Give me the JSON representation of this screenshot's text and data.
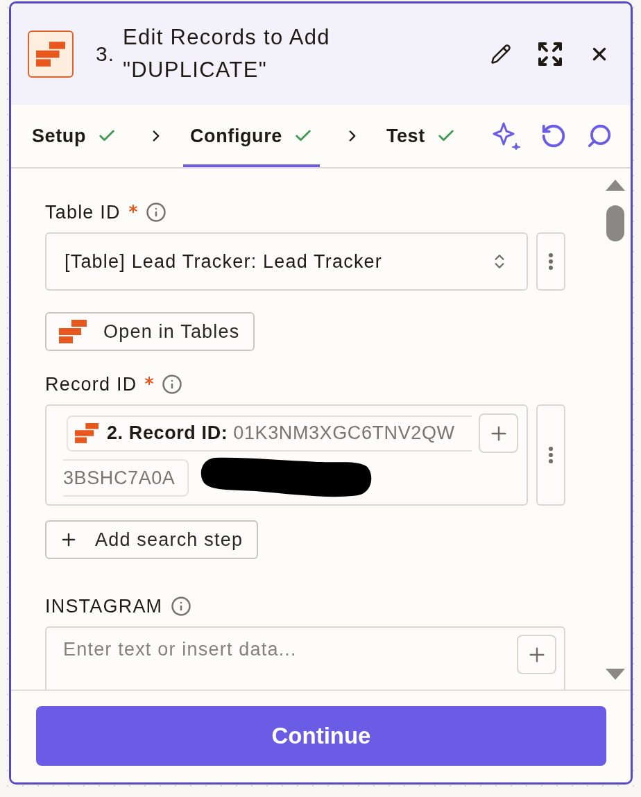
{
  "header": {
    "step_number": "3.",
    "title": "Edit Records to Add \"DUPLICATE\""
  },
  "tabs": [
    {
      "label": "Setup",
      "done": true,
      "selected": false
    },
    {
      "label": "Configure",
      "done": true,
      "selected": true
    },
    {
      "label": "Test",
      "done": true,
      "selected": false
    }
  ],
  "fields": [
    {
      "kind": "select",
      "label": "Table ID",
      "required": true,
      "value": "[Table] Lead Tracker: Lead Tracker",
      "button": "Open in Tables"
    },
    {
      "kind": "mapped",
      "label": "Record ID",
      "required": true,
      "chip": {
        "source": "2. Record ID:",
        "value": "01K3NM3XGC6TNV2QW",
        "continuation": "3BSHC7A0A"
      },
      "button": "Add search step"
    },
    {
      "kind": "text",
      "label": "INSTAGRAM",
      "required": false,
      "placeholder": "Enter text or insert data..."
    }
  ],
  "footer": {
    "button": "Continue"
  }
}
